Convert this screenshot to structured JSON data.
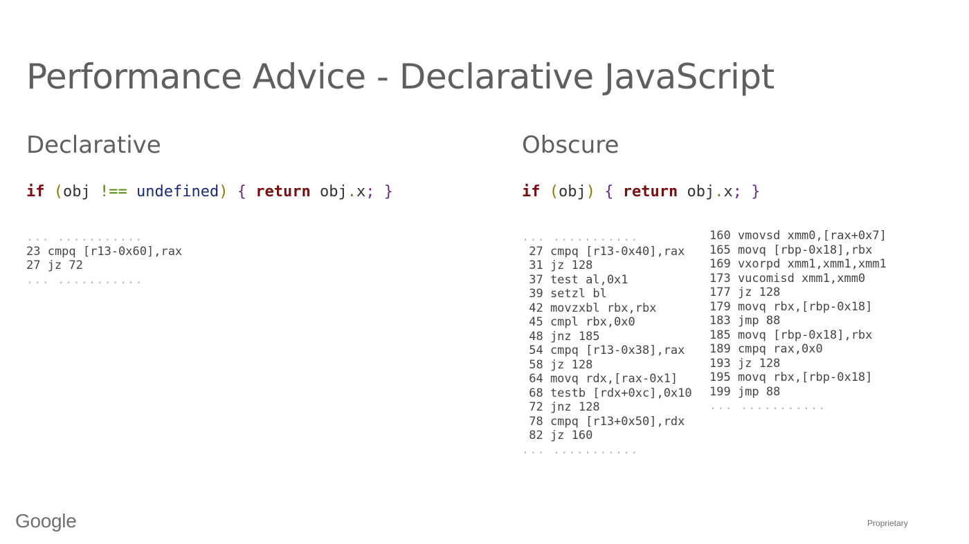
{
  "slide": {
    "title": "Performance Advice - Declarative JavaScript",
    "footer_logo": "Google",
    "footer_label": "Proprietary"
  },
  "left": {
    "heading": "Declarative",
    "code": {
      "if": "if",
      "open_paren": "(",
      "expr_obj": "obj",
      "op": "!==",
      "undefined": "undefined",
      "close_paren": ")",
      "open_brace": "{",
      "return": "return",
      "ret_obj": "obj",
      "dot": ".",
      "prop": "x",
      "semi": ";",
      "close_brace": "}"
    },
    "asm": [
      "... ...........",
      "23 cmpq [r13-0x60],rax",
      "27 jz 72",
      "... ..........."
    ]
  },
  "right": {
    "heading": "Obscure",
    "code": {
      "if": "if",
      "open_paren": "(",
      "expr_obj": "obj",
      "close_paren": ")",
      "open_brace": "{",
      "return": "return",
      "ret_obj": "obj",
      "dot": ".",
      "prop": "x",
      "semi": ";",
      "close_brace": "}"
    },
    "asm_col1": [
      "... ...........",
      " 27 cmpq [r13-0x40],rax",
      " 31 jz 128",
      " 37 test al,0x1",
      " 39 setzl bl",
      " 42 movzxbl rbx,rbx",
      " 45 cmpl rbx,0x0",
      " 48 jnz 185",
      " 54 cmpq [r13-0x38],rax",
      " 58 jz 128",
      " 64 movq rdx,[rax-0x1]",
      " 68 testb [rdx+0xc],0x10",
      " 72 jnz 128",
      " 78 cmpq [r13+0x50],rdx",
      " 82 jz 160",
      "... ..........."
    ],
    "asm_col2": [
      "160 vmovsd xmm0,[rax+0x7]",
      "165 movq [rbp-0x18],rbx",
      "169 vxorpd xmm1,xmm1,xmm1",
      "173 vucomisd xmm1,xmm0",
      "177 jz 128",
      "179 movq rbx,[rbp-0x18]",
      "183 jmp 88",
      "185 movq [rbp-0x18],rbx",
      "189 cmpq rax,0x0",
      "193 jz 128",
      "195 movq rbx,[rbp-0x18]",
      "199 jmp 88",
      "... ..........."
    ]
  }
}
